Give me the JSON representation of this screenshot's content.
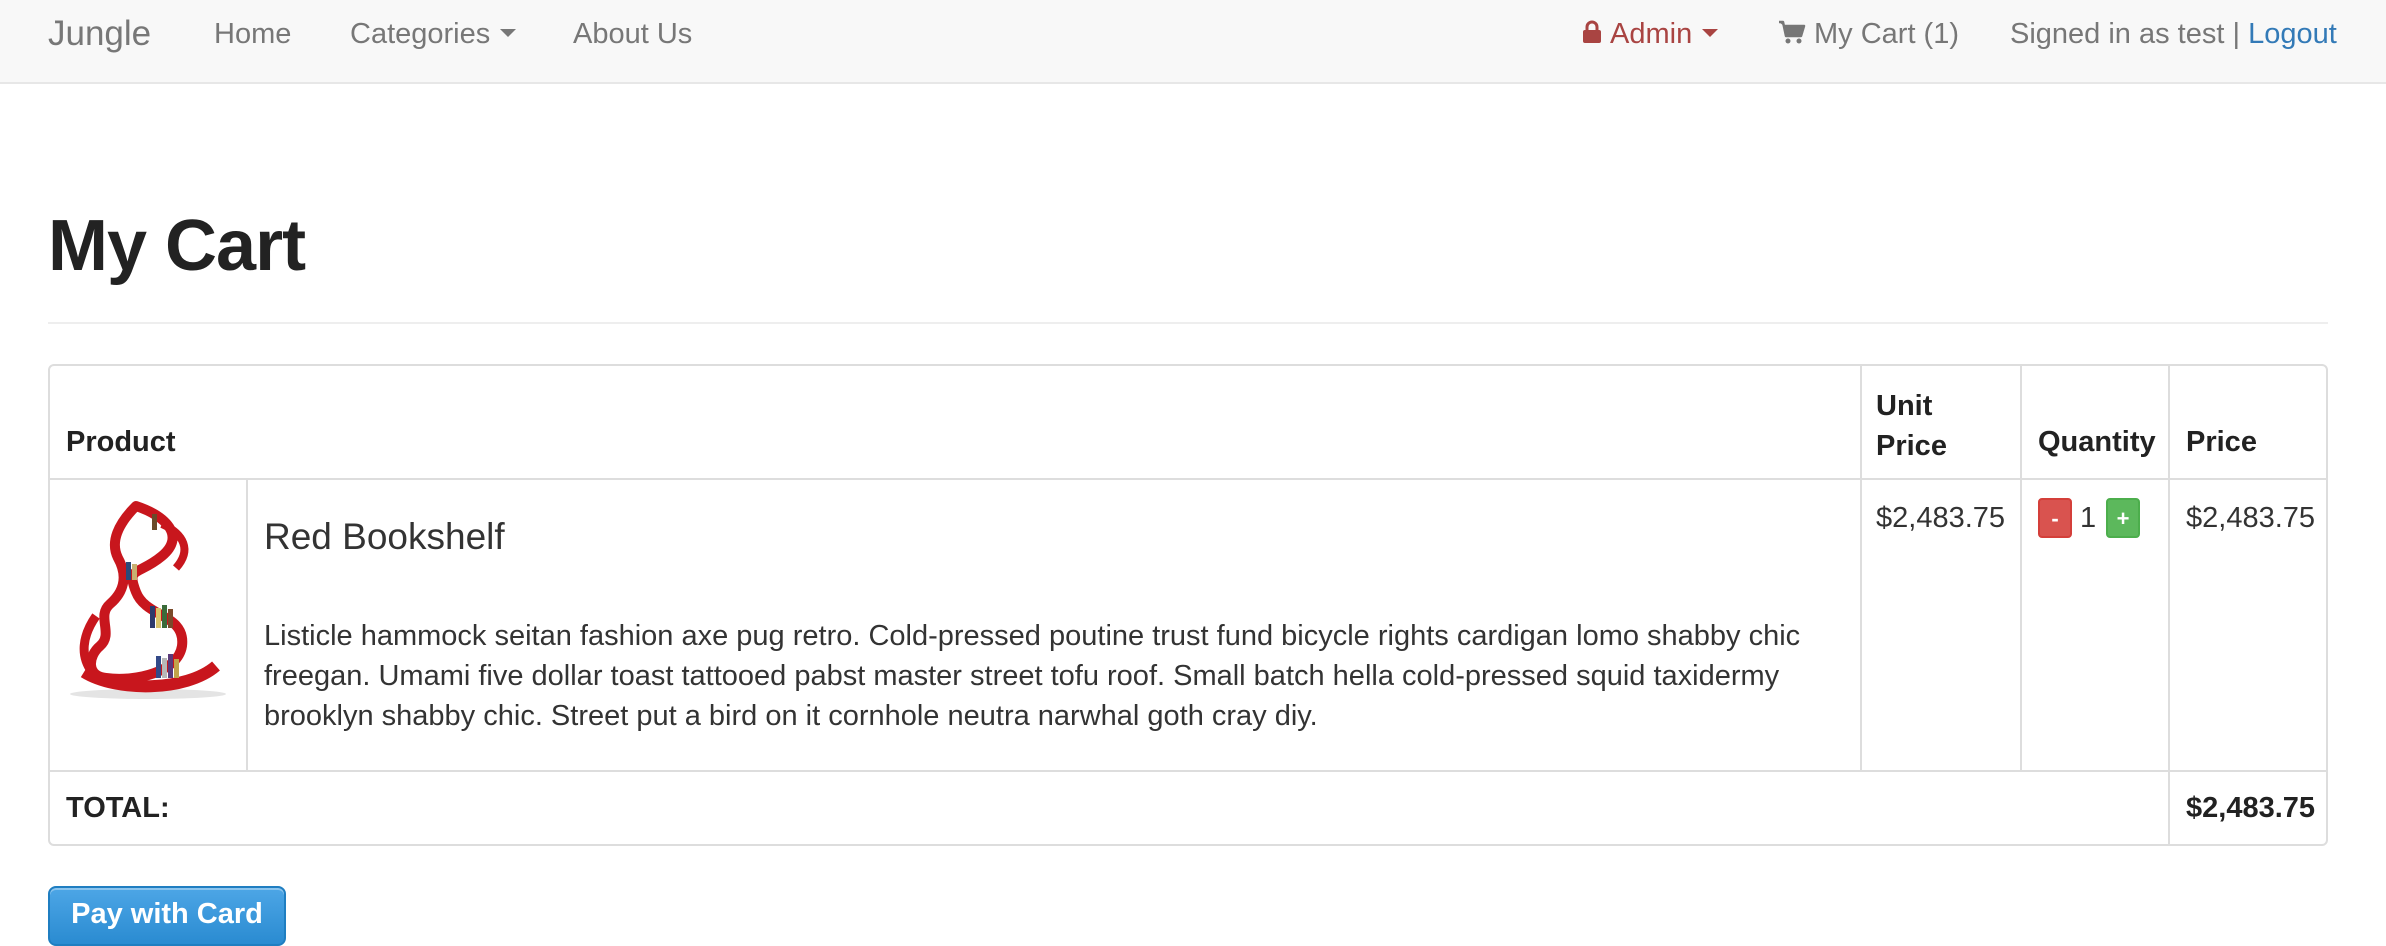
{
  "navbar": {
    "brand": "Jungle",
    "home": "Home",
    "categories": "Categories",
    "about": "About Us",
    "admin": "Admin",
    "cart": "My Cart (1)",
    "signed_in": "Signed in as test | ",
    "logout": "Logout",
    "icons": {
      "admin": "lock-icon",
      "cart": "shopping-cart-icon"
    },
    "colors": {
      "admin": "#a94442",
      "link": "#337ab7"
    }
  },
  "page": {
    "title": "My Cart"
  },
  "cart_table": {
    "headers": {
      "product": "Product",
      "unit_price": "Unit Price",
      "quantity": "Quantity",
      "price": "Price"
    },
    "items": [
      {
        "image": "red-bookshelf-thumbnail",
        "name": "Red Bookshelf",
        "description": "Listicle hammock seitan fashion axe pug retro. Cold-pressed poutine trust fund bicycle rights cardigan lomo shabby chic freegan. Umami five dollar toast tattooed pabst master street tofu roof. Small batch hella cold-pressed squid taxidermy brooklyn shabby chic. Street put a bird on it cornhole neutra narwhal goth cray diy.",
        "unit_price": "$2,483.75",
        "quantity": "1",
        "minus_label": "-",
        "plus_label": "+",
        "price": "$2,483.75"
      }
    ],
    "total_label": "TOTAL:",
    "total_value": "$2,483.75"
  },
  "checkout": {
    "pay_label": "Pay with Card"
  }
}
